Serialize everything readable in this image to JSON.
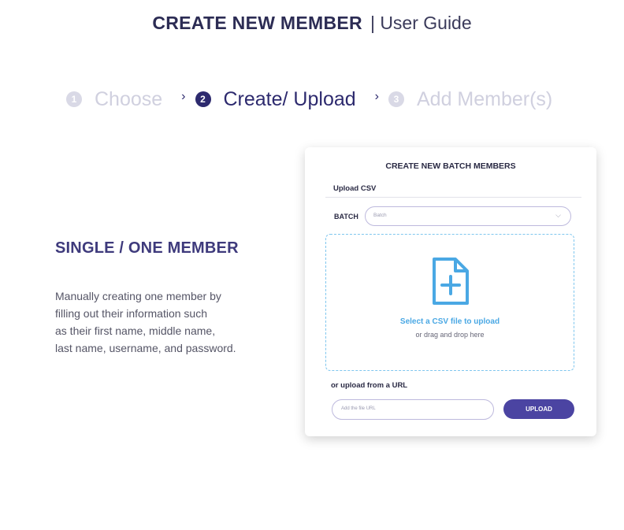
{
  "header": {
    "title_strong": "CREATE NEW MEMBER",
    "title_rest": "| User Guide"
  },
  "steps": [
    {
      "number": "1",
      "label": "Choose",
      "state": "inactive"
    },
    {
      "number": "2",
      "label": "Create/ Upload",
      "state": "active"
    },
    {
      "number": "3",
      "label": "Add Member(s)",
      "state": "inactive"
    }
  ],
  "step_separator": "›",
  "single": {
    "title": "SINGLE / ONE MEMBER",
    "desc_lines": [
      "Manually creating one member by",
      "filling out their information such",
      "as their first name, middle name,",
      "last name, username, and password."
    ]
  },
  "card": {
    "title": "CREATE  NEW BATCH MEMBERS",
    "tab_label": "Upload CSV",
    "batch_label": "BATCH",
    "batch_placeholder": "Batch",
    "dropzone_main": "Select a CSV file to upload",
    "dropzone_sub": "or drag and drop here",
    "url_label": "or upload from a URL",
    "url_placeholder": "Add the file URL",
    "upload_button": "UPLOAD"
  },
  "icons": {
    "file": "file-plus-icon",
    "chevron": "chevron-down-icon"
  },
  "colors": {
    "active_step": "#2d2a6e",
    "inactive_step": "#d0d0df",
    "accent": "#4b44a2",
    "dropzone_accent": "#4aa8e4"
  }
}
